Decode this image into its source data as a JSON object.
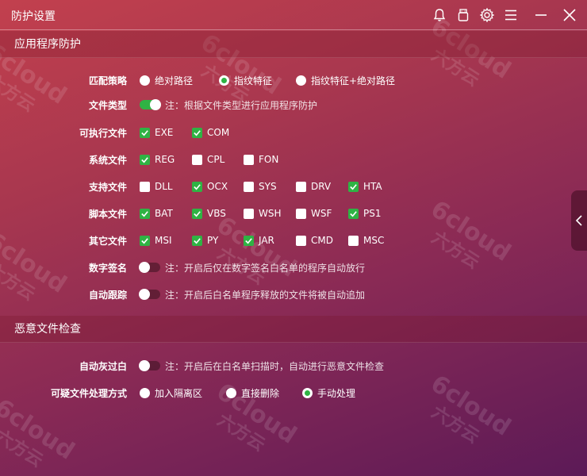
{
  "window": {
    "title": "防护设置"
  },
  "sections": {
    "app_protect": "应用程序防护",
    "malware_check": "恶意文件检查"
  },
  "match_policy": {
    "label": "匹配策略",
    "options": [
      "绝对路径",
      "指纹特征",
      "指纹特征+绝对路径"
    ],
    "selected": 1
  },
  "file_type": {
    "label": "文件类型",
    "enabled": true,
    "note": "注：根据文件类型进行应用程序防护"
  },
  "executable": {
    "label": "可执行文件",
    "items": [
      {
        "name": "EXE",
        "checked": true
      },
      {
        "name": "COM",
        "checked": true
      }
    ]
  },
  "system": {
    "label": "系统文件",
    "items": [
      {
        "name": "REG",
        "checked": true
      },
      {
        "name": "CPL",
        "checked": false
      },
      {
        "name": "FON",
        "checked": false
      }
    ]
  },
  "support": {
    "label": "支持文件",
    "items": [
      {
        "name": "DLL",
        "checked": false
      },
      {
        "name": "OCX",
        "checked": true
      },
      {
        "name": "SYS",
        "checked": false
      },
      {
        "name": "DRV",
        "checked": false
      },
      {
        "name": "HTA",
        "checked": true
      }
    ]
  },
  "script": {
    "label": "脚本文件",
    "items": [
      {
        "name": "BAT",
        "checked": true
      },
      {
        "name": "VBS",
        "checked": true
      },
      {
        "name": "WSH",
        "checked": false
      },
      {
        "name": "WSF",
        "checked": false
      },
      {
        "name": "PS1",
        "checked": true
      }
    ]
  },
  "other": {
    "label": "其它文件",
    "items": [
      {
        "name": "MSI",
        "checked": true
      },
      {
        "name": "PY",
        "checked": true
      },
      {
        "name": "JAR",
        "checked": true
      },
      {
        "name": "CMD",
        "checked": false
      },
      {
        "name": "MSC",
        "checked": false
      }
    ]
  },
  "digital_sign": {
    "label": "数字签名",
    "enabled": false,
    "note": "注：开启后仅在数字签名白名单的程序自动放行"
  },
  "auto_track": {
    "label": "自动跟踪",
    "enabled": false,
    "note": "注：开启后白名单程序释放的文件将被自动追加"
  },
  "auto_whitelist": {
    "label": "自动灰过白",
    "enabled": false,
    "note": "注：开启后在白名单扫描时，自动进行恶意文件检查"
  },
  "suspicious_handling": {
    "label": "可疑文件处理方式",
    "options": [
      "加入隔离区",
      "直接删除",
      "手动处理"
    ],
    "selected": 2
  },
  "watermark": {
    "text_en": "6cloud",
    "text_cn": "六方云"
  }
}
